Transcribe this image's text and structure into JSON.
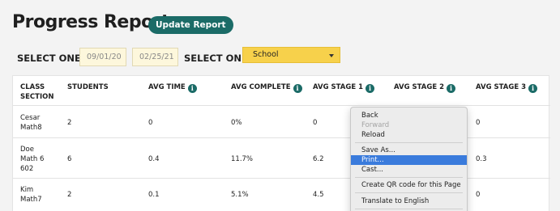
{
  "header": {
    "title": "Progress Report",
    "update_button": "Update Report"
  },
  "filters": {
    "select_label_1": "SELECT ONE:",
    "start_date": "09/01/20",
    "end_date": "02/25/21",
    "select_label_2": "SELECT ONE:",
    "scope_value": "School"
  },
  "table": {
    "headers": {
      "class_section_1": "CLASS",
      "class_section_2": "SECTION",
      "students": "STUDENTS",
      "avg_time": "AVG TIME",
      "avg_complete": "AVG COMPLETE",
      "avg_stage1": "AVG STAGE 1",
      "avg_stage2": "AVG STAGE 2",
      "avg_stage3": "AVG STAGE 3"
    },
    "rows": [
      {
        "section_line1": "Cesar",
        "section_line2": "Math8",
        "section_line3": "",
        "students": "2",
        "avg_time": "0",
        "avg_complete": "0%",
        "avg_stage1": "0",
        "avg_stage3": "0"
      },
      {
        "section_line1": "Doe",
        "section_line2": "Math 6",
        "section_line3": "602",
        "students": "6",
        "avg_time": "0.4",
        "avg_complete": "11.7%",
        "avg_stage1": "6.2",
        "avg_stage3": "0.3"
      },
      {
        "section_line1": "Kim",
        "section_line2": "Math7",
        "section_line3": "",
        "students": "2",
        "avg_time": "0.1",
        "avg_complete": "5.1%",
        "avg_stage1": "4.5",
        "avg_stage3": "0"
      }
    ]
  },
  "context_menu": {
    "back": "Back",
    "forward": "Forward",
    "reload": "Reload",
    "save_as": "Save As...",
    "print": "Print...",
    "cast": "Cast...",
    "qr_code": "Create QR code for this Page",
    "translate": "Translate to English"
  },
  "colors": {
    "accent": "#1b6b67",
    "select_yellow": "#f7d14b",
    "menu_highlight": "#3a7bdc"
  }
}
